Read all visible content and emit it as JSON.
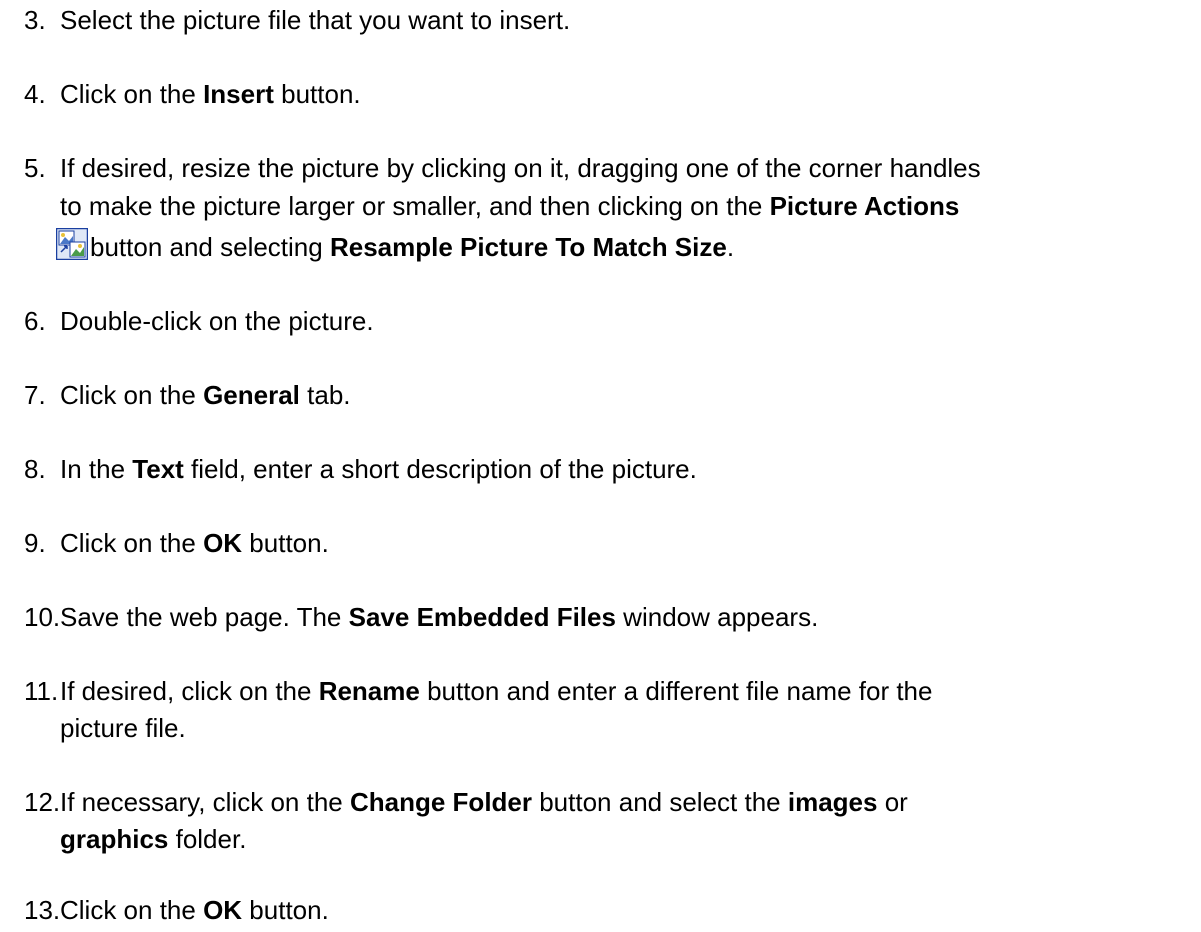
{
  "steps": [
    {
      "num": "3.",
      "parts": [
        {
          "t": "Select the picture file that you want to insert."
        }
      ]
    },
    {
      "num": "4.",
      "parts": [
        {
          "t": "Click on the "
        },
        {
          "t": "Insert",
          "b": true
        },
        {
          "t": " button."
        }
      ]
    },
    {
      "num": "5.",
      "line1": [
        {
          "t": "If desired, resize the picture by clicking on it, dragging one of the corner handles"
        }
      ],
      "line2": [
        {
          "t": "to make the picture larger or smaller, and then clicking on the "
        },
        {
          "t": "Picture Actions",
          "b": true
        }
      ],
      "line3": [
        {
          "t": "button and selecting "
        },
        {
          "t": "Resample Picture To Match Size",
          "b": true
        },
        {
          "t": "."
        }
      ]
    },
    {
      "num": "6.",
      "parts": [
        {
          "t": "Double-click on the picture."
        }
      ]
    },
    {
      "num": "7.",
      "parts": [
        {
          "t": "Click on the "
        },
        {
          "t": "General",
          "b": true
        },
        {
          "t": " tab."
        }
      ]
    },
    {
      "num": "8.",
      "parts": [
        {
          "t": "In the "
        },
        {
          "t": "Text",
          "b": true
        },
        {
          "t": " field, enter a short description of the picture."
        }
      ]
    },
    {
      "num": "9.",
      "parts": [
        {
          "t": "Click on the "
        },
        {
          "t": "OK",
          "b": true
        },
        {
          "t": " button."
        }
      ]
    },
    {
      "num": "10.",
      "parts": [
        {
          "t": "Save the web page. The "
        },
        {
          "t": "Save Embedded Files",
          "b": true
        },
        {
          "t": " window appears."
        }
      ]
    },
    {
      "num": "11.",
      "line1": [
        {
          "t": "If desired, click on the "
        },
        {
          "t": "Rename",
          "b": true
        },
        {
          "t": " button and enter a different file name for the"
        }
      ],
      "line2": [
        {
          "t": "picture file."
        }
      ]
    },
    {
      "num": "12.",
      "line1": [
        {
          "t": "If necessary, click on the "
        },
        {
          "t": "Change Folder",
          "b": true
        },
        {
          "t": " button and select the "
        },
        {
          "t": "images",
          "b": true
        },
        {
          "t": " or"
        }
      ],
      "line2": [
        {
          "t": "graphics",
          "b": true
        },
        {
          "t": " folder."
        }
      ]
    },
    {
      "num": "13.",
      "parts": [
        {
          "t": "Click on the "
        },
        {
          "t": "OK",
          "b": true
        },
        {
          "t": " button."
        }
      ]
    }
  ],
  "icon": {
    "name": "picture-actions-icon",
    "border": "#1a3fa0",
    "fill": "#4a78c8",
    "accent": "#e8c23a"
  }
}
